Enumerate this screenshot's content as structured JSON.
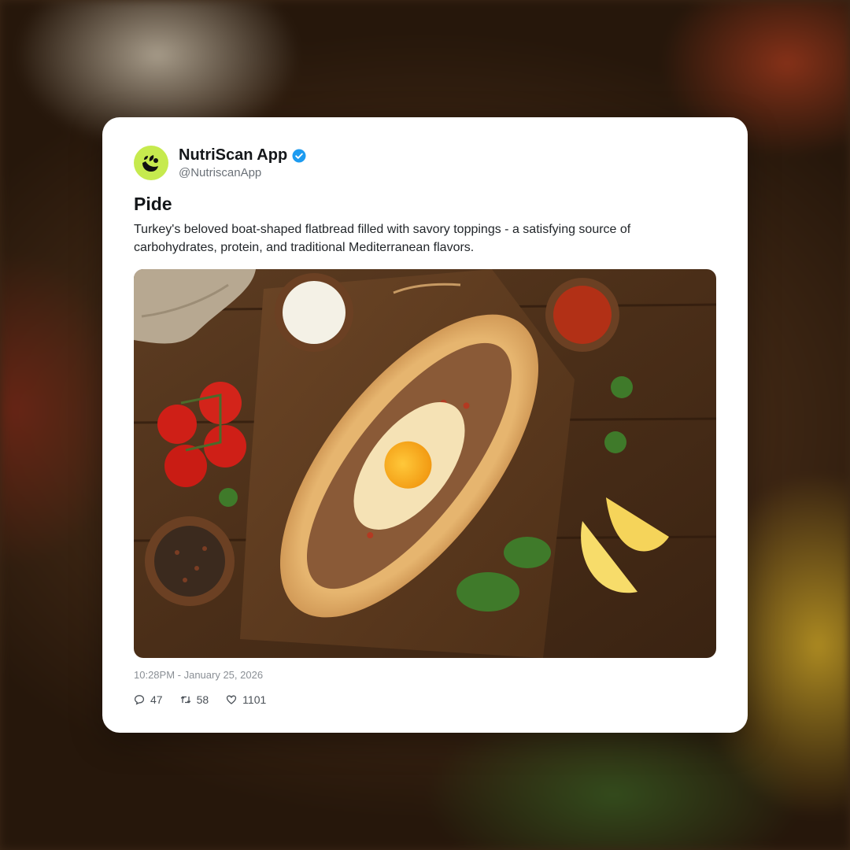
{
  "post": {
    "display_name": "NutriScan App",
    "handle": "@NutriscanApp",
    "verified": true,
    "title": "Pide",
    "description": "Turkey's beloved boat-shaped flatbread filled with savory toppings - a satisfying source of carbohydrates, protein, and traditional Mediterranean flavors.",
    "timestamp": "10:28PM - January 25, 2026",
    "image_icon": "food-photo-pide",
    "stats": {
      "replies": "47",
      "retweets": "58",
      "likes": "1101"
    }
  },
  "colors": {
    "avatar_bg": "#c6ea4e",
    "verified_badge": "#1d9bf0",
    "card_bg": "#ffffff"
  }
}
